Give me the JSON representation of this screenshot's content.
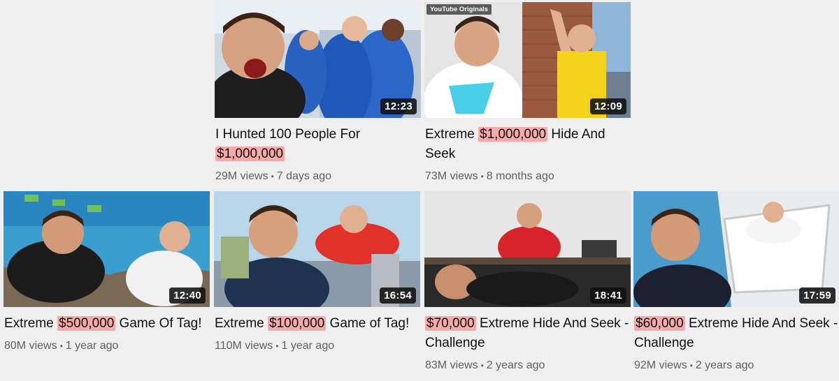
{
  "videos": [
    {
      "title_pre": "I Hunted 100 People For ",
      "title_hl": "$1,000,000",
      "title_post": "",
      "duration": "12:23",
      "views": "29M views",
      "age": "7 days ago"
    },
    {
      "title_pre": "Extreme ",
      "title_hl": "$1,000,000",
      "title_post": " Hide And Seek",
      "duration": "12:09",
      "views": "73M views",
      "age": "8 months ago",
      "badge": "YouTube Originals"
    },
    {
      "title_pre": "Extreme ",
      "title_hl": "$500,000",
      "title_post": " Game Of Tag!",
      "duration": "12:40",
      "views": "80M views",
      "age": "1 year ago"
    },
    {
      "title_pre": "Extreme ",
      "title_hl": "$100,000",
      "title_post": " Game of Tag!",
      "duration": "16:54",
      "views": "110M views",
      "age": "1 year ago"
    },
    {
      "title_pre": "",
      "title_hl": "$70,000",
      "title_post": " Extreme Hide And Seek - Challenge",
      "duration": "18:41",
      "views": "83M views",
      "age": "2 years ago"
    },
    {
      "title_pre": "",
      "title_hl": "$60,000",
      "title_post": " Extreme Hide And Seek - Challenge",
      "duration": "17:59",
      "views": "92M views",
      "age": "2 years ago"
    }
  ],
  "separator": "•",
  "colors": {
    "highlight": "#f5a9a9",
    "background": "#efefef",
    "meta": "#606060"
  }
}
